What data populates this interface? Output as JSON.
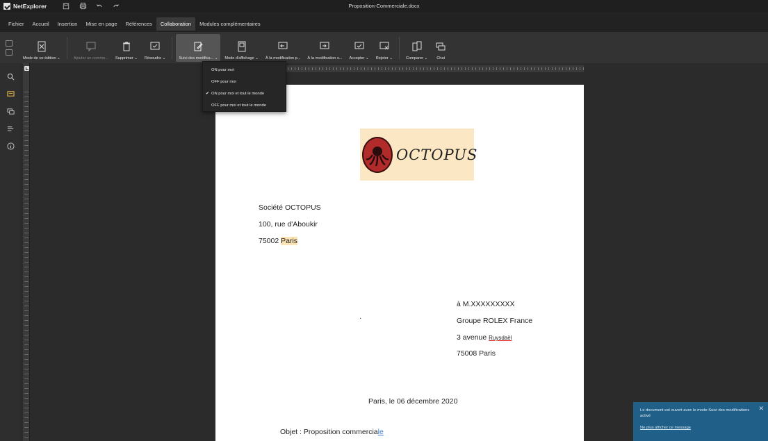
{
  "app": {
    "name": "NetExplorer",
    "document_title": "Proposition-Commerciale.docx"
  },
  "menu": [
    "Fichier",
    "Accueil",
    "Insertion",
    "Mise en page",
    "Références",
    "Collaboration",
    "Modules complémentaires"
  ],
  "menu_active": "Collaboration",
  "ribbon": {
    "coedit": "Mode de co-édition ⌄",
    "add_comment": "Ajouter un comme...",
    "delete": "Supprimer ⌄",
    "resolve": "Résoudre ⌄",
    "track_changes": "Suivi des modifica... ⌄",
    "display_mode": "Mode d'affichage ⌄",
    "prev_change": "À la modification p...",
    "next_change": "À la modification s...",
    "accept": "Accepter ⌄",
    "reject": "Rejeter ⌄",
    "compare": "Comparer ⌄",
    "chat": "Chat"
  },
  "dropdown": {
    "items": [
      "ON pour moi",
      "OFF pour moi",
      "ON pour moi et tout le monde",
      "OFF pour moi et tout le monde"
    ],
    "checked_index": 2
  },
  "page": {
    "logo_text": "OCTOPUS",
    "sender": {
      "company": "Société OCTOPUS",
      "street": "100, rue d'Aboukir",
      "zip": "75002 ",
      "city": "Paris"
    },
    "recipient": {
      "name": "à M.XXXXXXXXX",
      "company": "Groupe ROLEX France",
      "street_prefix": "3 avenue ",
      "street_name": "Ruysdaël",
      "city": "75008 Paris"
    },
    "dot": "·",
    "date": "Paris, le 06 décembre 2020",
    "object_prefix": "Objet : Proposition commercia",
    "object_suffix": "le"
  },
  "toast": {
    "message": "Le document est ouvert avec le mode Suivi des modifications activé",
    "link": "Ne plus afficher ce message",
    "close": "✕"
  },
  "colors": {
    "toast_bg": "#1f5f88",
    "highlight": "#fbe4b4",
    "logo_bg": "#fbe7c3",
    "logo_red": "#b22b2b"
  }
}
